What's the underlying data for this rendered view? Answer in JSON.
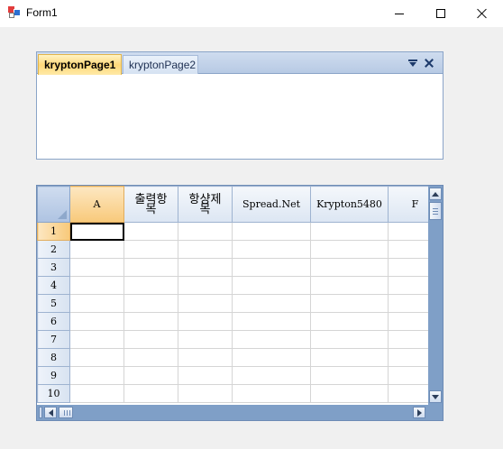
{
  "window": {
    "title": "Form1",
    "icon": "winforms-app-icon"
  },
  "navigator": {
    "tabs": [
      {
        "label": "kryptonPage1",
        "active": true
      },
      {
        "label": "kryptonPage2",
        "active": false
      }
    ],
    "buttons": [
      "dropdown-icon",
      "close-icon"
    ]
  },
  "spread": {
    "columns": [
      "A",
      "출력항목",
      "항샹제목",
      "Spread.Net",
      "Krypton5480",
      "F"
    ],
    "rows": [
      "1",
      "2",
      "3",
      "4",
      "5",
      "6",
      "7",
      "8",
      "9",
      "10"
    ],
    "active_cell": "A1"
  },
  "colors": {
    "active_tab": "#ffd97a",
    "header_highlight": "#f8c97a",
    "header_blue": "#dce6f3",
    "scrollbar": "#7f9fc7"
  }
}
